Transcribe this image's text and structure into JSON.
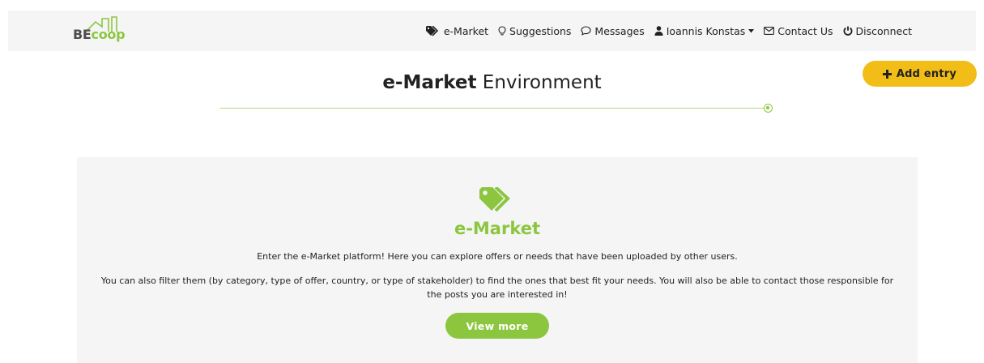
{
  "brand": {
    "logo_be": "BE",
    "logo_coop": "coop"
  },
  "nav": {
    "items": [
      {
        "label": "e-Market",
        "icon": "tags-icon"
      },
      {
        "label": "Suggestions",
        "icon": "lightbulb-icon"
      },
      {
        "label": "Messages",
        "icon": "chat-bubble-icon"
      },
      {
        "label": "Ioannis Konstas",
        "icon": "user-icon",
        "dropdown": true
      },
      {
        "label": "Contact Us",
        "icon": "envelope-icon"
      },
      {
        "label": "Disconnect",
        "icon": "power-icon"
      }
    ]
  },
  "actions": {
    "add_entry": "Add entry"
  },
  "header": {
    "title_bold": "e-Market",
    "title_rest": " Environment"
  },
  "card": {
    "title": "e-Market",
    "text1": "Enter the e-Market platform! Here you can explore offers or needs that have been uploaded by other users.",
    "text2": "You can also filter them (by category, type of offer, country, or type of stakeholder) to find the ones that best fit your needs. You will also be able to contact those responsible for the posts you are interested in!",
    "button": "View more"
  },
  "colors": {
    "accent_green": "#8cc63f",
    "accent_yellow": "#f2bd16",
    "panel_bg": "#f5f5f5"
  }
}
